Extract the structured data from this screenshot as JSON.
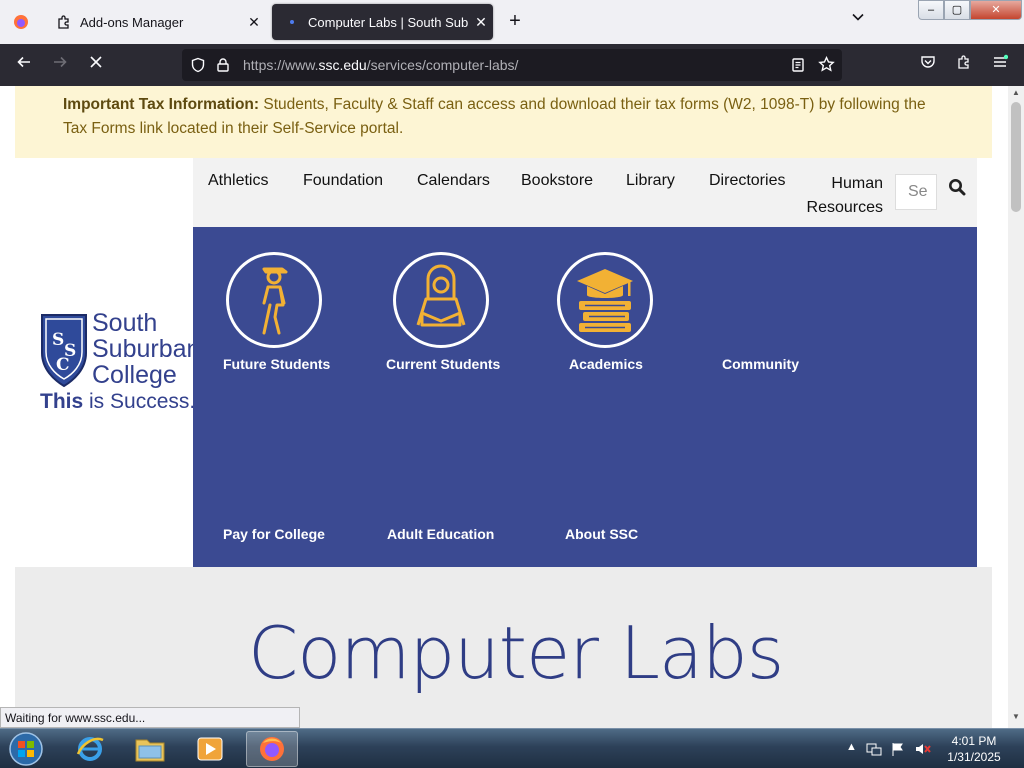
{
  "browser": {
    "tabs": [
      {
        "label": "Add-ons Manager",
        "close": "✕"
      },
      {
        "label": "Computer Labs | South Suburban College",
        "close": "✕"
      }
    ],
    "new_tab": "+",
    "window_controls": {
      "minimize": "–",
      "maximize": "▢",
      "close": "✕"
    },
    "url": {
      "prefix": "https://www.",
      "host": "ssc.edu",
      "path": "/services/computer-labs/"
    },
    "status": "Waiting for www.ssc.edu..."
  },
  "notice": {
    "bold": "Important Tax Information:",
    "text": " Students, Faculty & Staff can access and download their tax forms (W2, 1098-T) by following the Tax Forms link located in their Self-Service portal."
  },
  "logo": {
    "line1": "South",
    "line2": "Suburban",
    "line3": "College",
    "tag_bold": "This",
    "tag_rest": " is Success."
  },
  "top_nav": {
    "items": [
      "Athletics",
      "Foundation",
      "Calendars",
      "Bookstore",
      "Library",
      "Directories"
    ],
    "human_1": "Human",
    "human_2": "Resources",
    "search_placeholder": "Se"
  },
  "mega_menu": {
    "items": [
      "Future Students",
      "Current Students",
      "Academics",
      "Community",
      "Pay for College",
      "Adult Education",
      "About SSC"
    ],
    "accent": "#f2b134",
    "background": "#3b4a92"
  },
  "hero": {
    "title": "Computer Labs"
  },
  "taskbar": {
    "time": "4:01 PM",
    "date": "1/31/2025"
  }
}
